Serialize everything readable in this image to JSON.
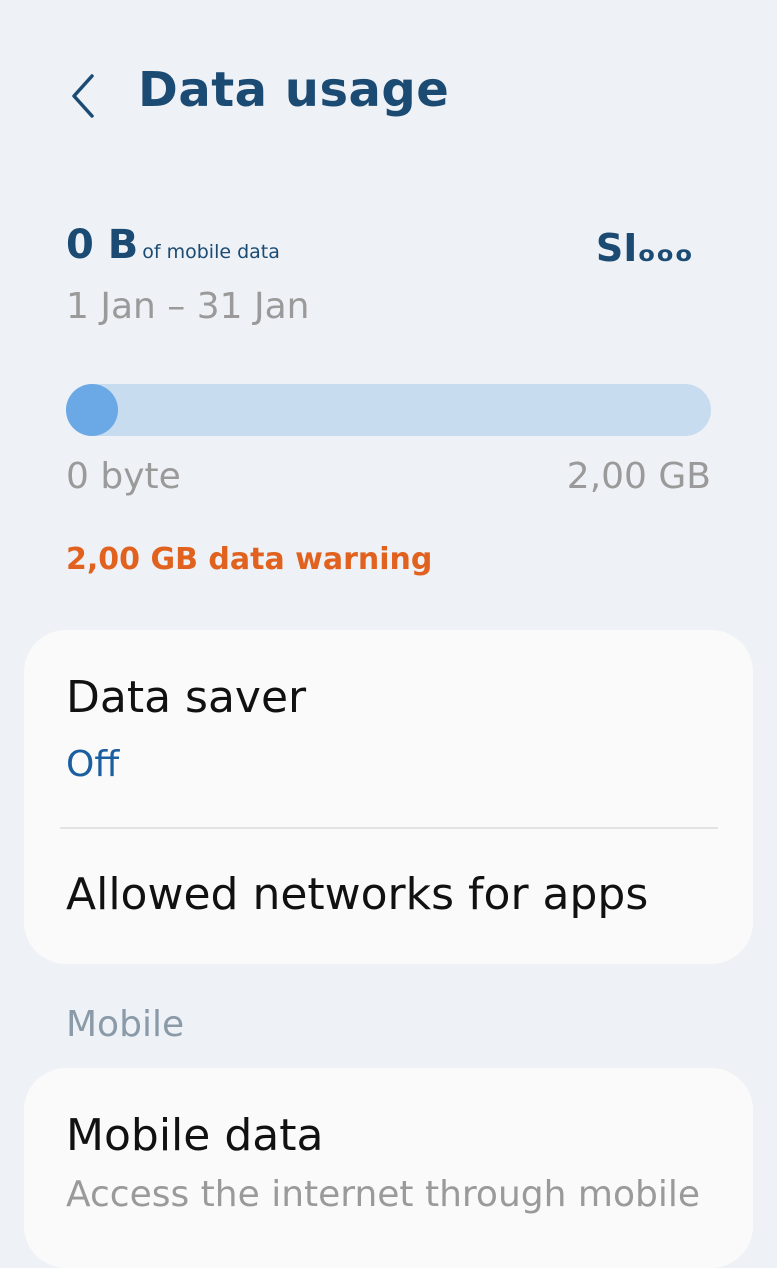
{
  "header": {
    "title": "Data usage",
    "back_icon": "chevron-left-icon"
  },
  "usage": {
    "amount": "0 B",
    "amount_suffix": "of mobile data",
    "sim": "SIₒₒₒ",
    "date_range": "1 Jan – 31 Jan",
    "progress_fraction": 0,
    "range_min": "0 byte",
    "range_max": "2,00 GB",
    "warning": "2,00 GB data warning",
    "warning_color": "#e1621e",
    "track_color": "#c8dcf0",
    "fill_color": "#6aa9e6"
  },
  "settings": {
    "data_saver": {
      "title": "Data saver",
      "status": "Off"
    },
    "allowed_networks": {
      "title": "Allowed networks for apps"
    }
  },
  "mobile_section": {
    "label": "Mobile",
    "mobile_data": {
      "title": "Mobile data",
      "subtitle": "Access the internet through mobile"
    }
  },
  "colors": {
    "accent": "#1b4a73",
    "background": "#eef1f5",
    "card": "#fafafa"
  }
}
